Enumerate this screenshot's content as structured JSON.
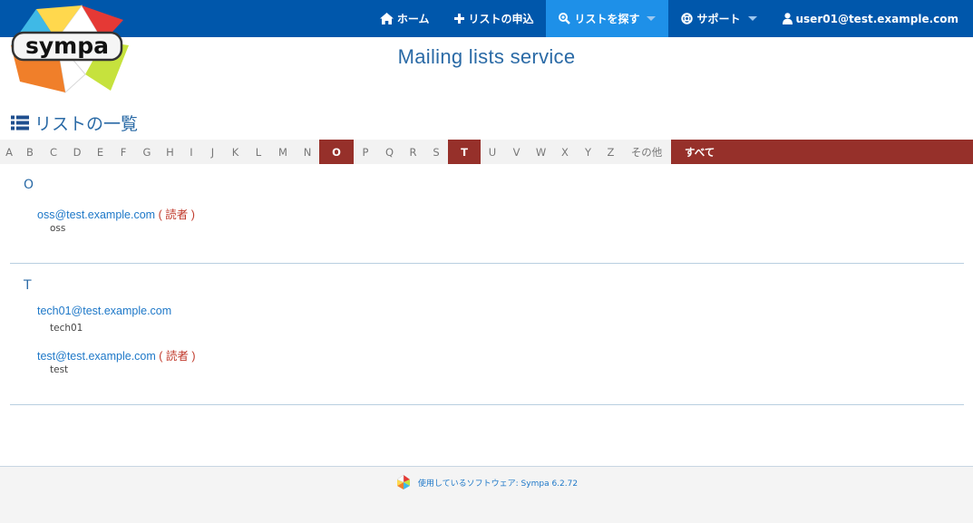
{
  "nav": {
    "home_label": "ホーム",
    "request_label": "リストの申込",
    "search_label": "リストを探す",
    "support_label": "サポート",
    "user_label": "user01@test.example.com"
  },
  "logo_text": "sympa",
  "site_title": "Mailing lists service",
  "page_heading": "リストの一覧",
  "letters": [
    "A",
    "B",
    "C",
    "D",
    "E",
    "F",
    "G",
    "H",
    "I",
    "J",
    "K",
    "L",
    "M",
    "N",
    "O",
    "P",
    "Q",
    "R",
    "S",
    "T",
    "U",
    "V",
    "W",
    "X",
    "Y",
    "Z",
    "その他"
  ],
  "active_letters": [
    "O",
    "T"
  ],
  "all_label": "すべて",
  "groups": [
    {
      "letter": "O",
      "entries": [
        {
          "address": "oss@test.example.com",
          "role": "( 読者 )",
          "description": "oss"
        }
      ]
    },
    {
      "letter": "T",
      "entries": [
        {
          "address": "tech01@test.example.com",
          "role": "",
          "description": "tech01"
        },
        {
          "address": "test@test.example.com",
          "role": "( 読者 )",
          "description": "test"
        }
      ]
    }
  ],
  "footer": {
    "text": "使用しているソフトウェア: Sympa 6.2.72"
  },
  "colors": {
    "navbar": "#0057ab",
    "nav_active": "#1e90e8",
    "letter_active": "#96302a",
    "link": "#1e78c8",
    "role": "#c0392b",
    "title": "#2a6aa6"
  }
}
